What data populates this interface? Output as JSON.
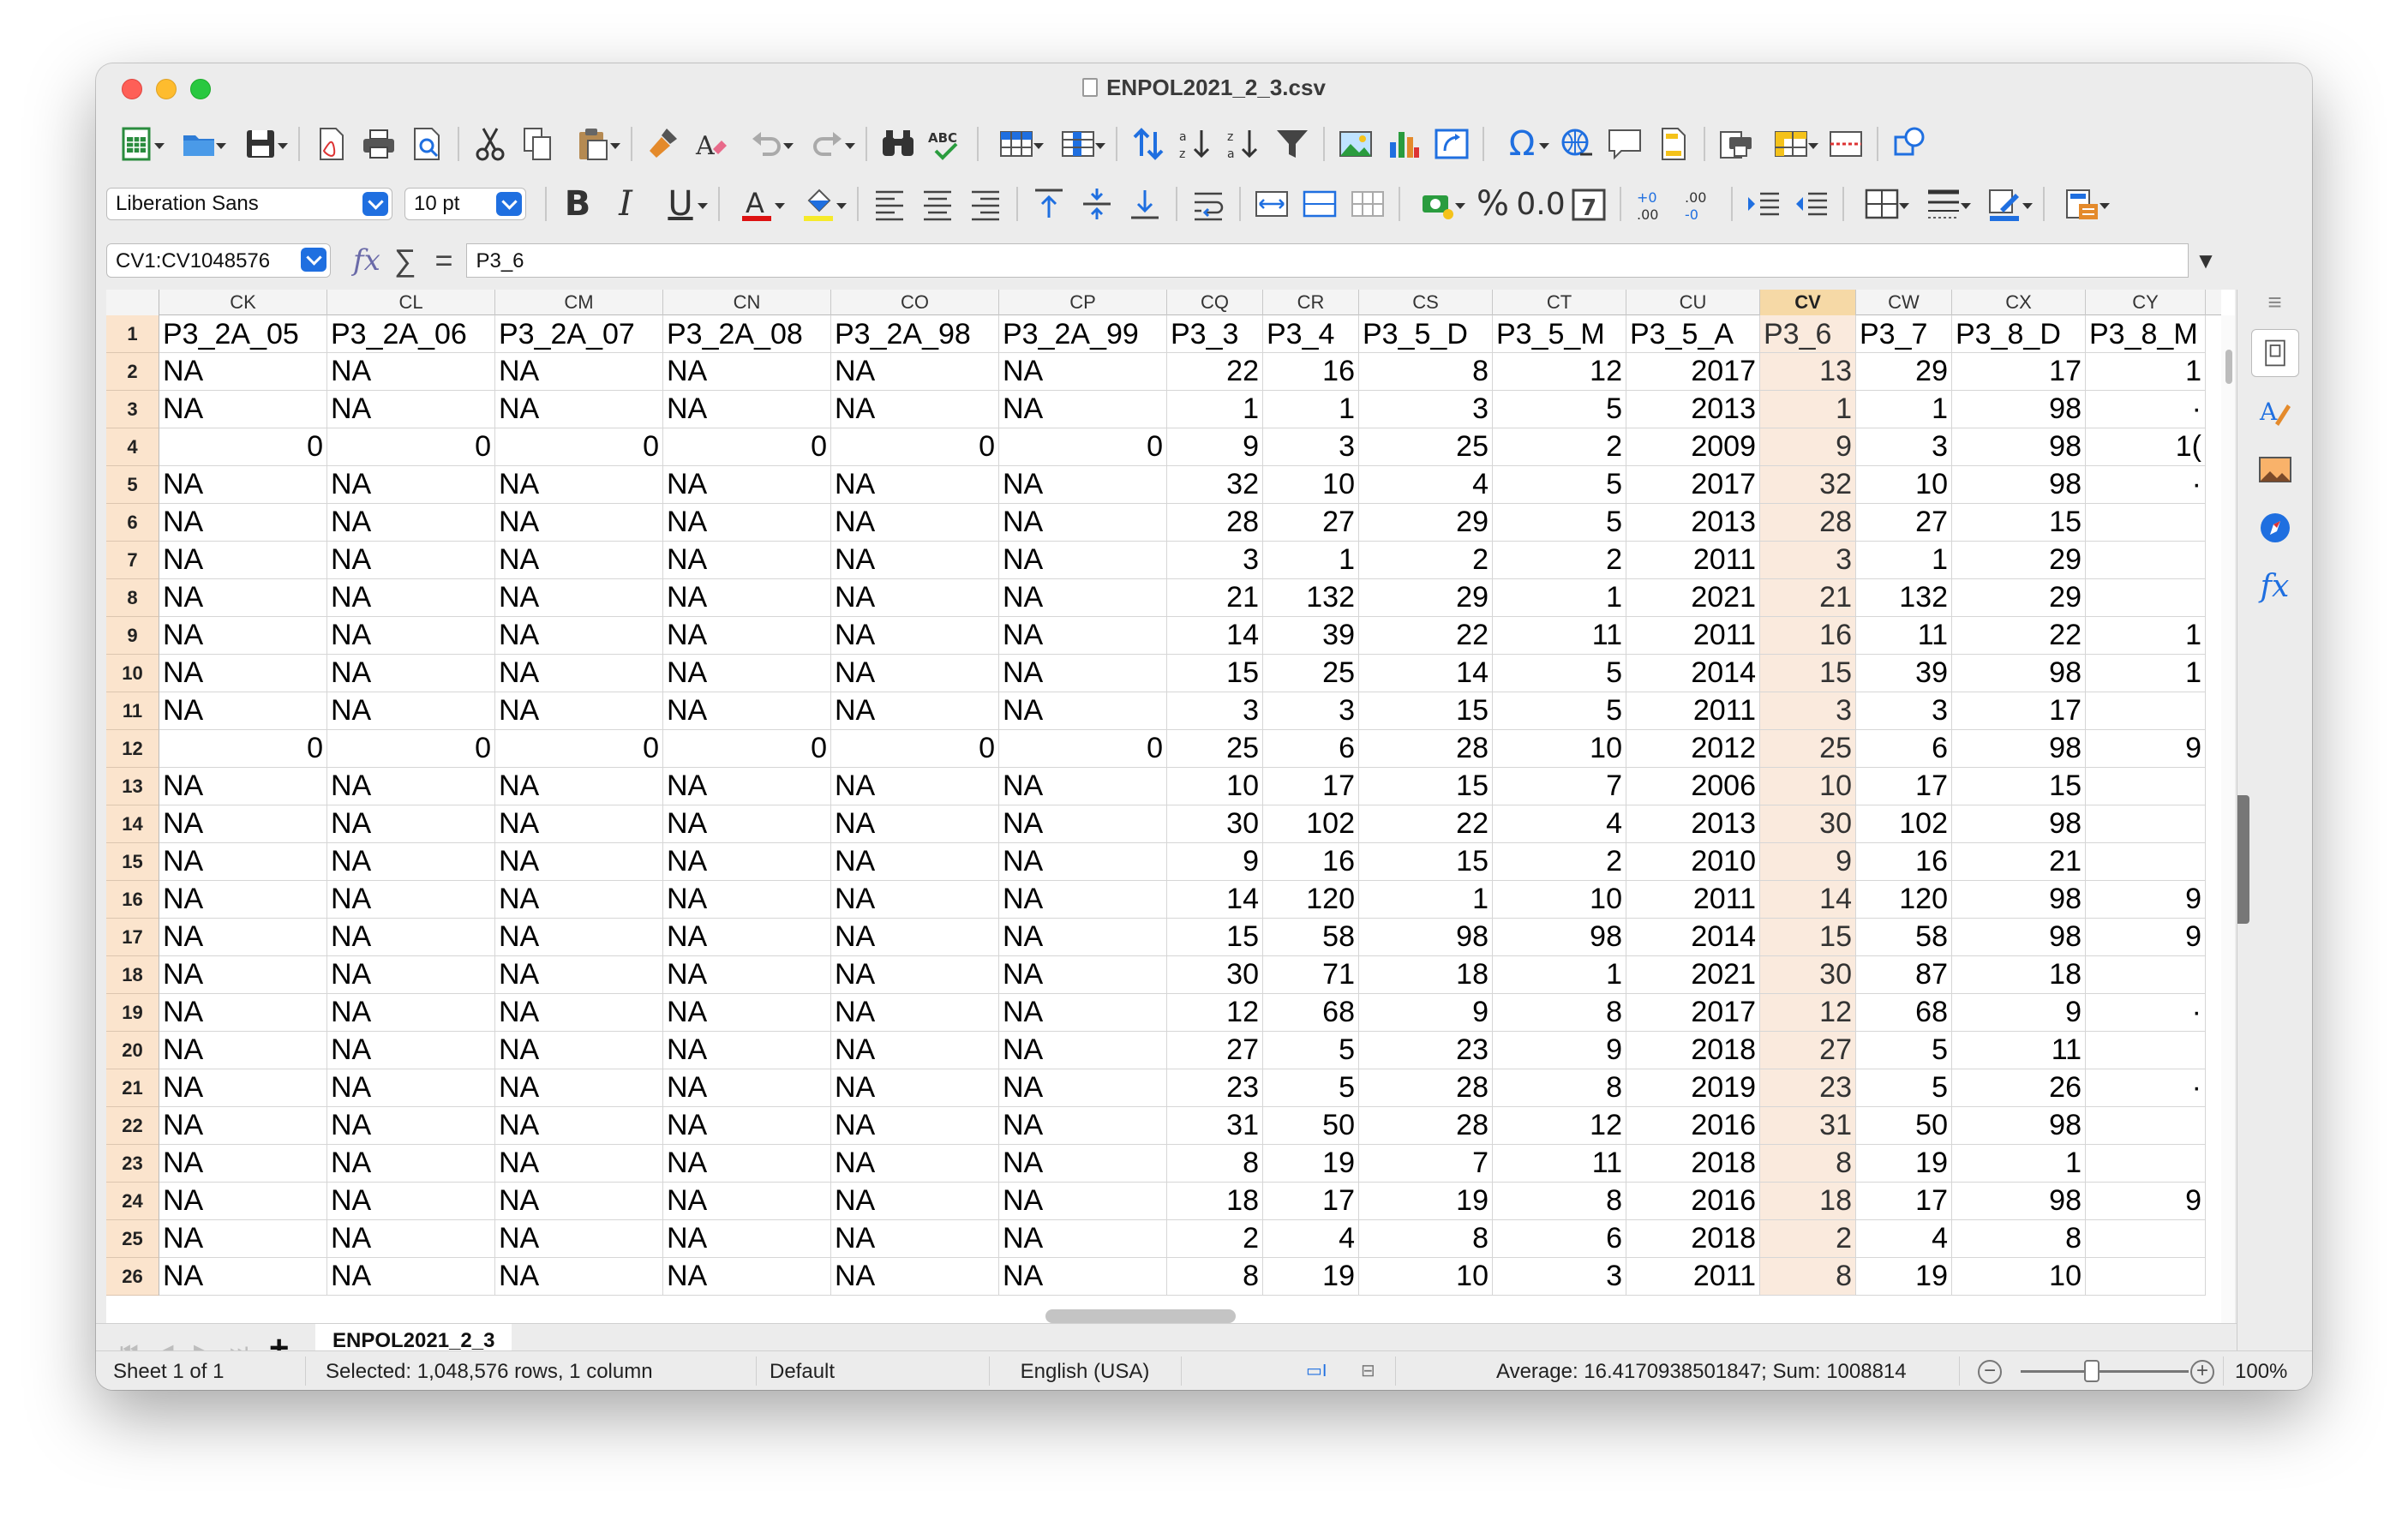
{
  "window": {
    "title": "ENPOL2021_2_3.csv"
  },
  "toolbar2": {
    "font_name": "Liberation Sans",
    "font_size": "10 pt",
    "percent": "%",
    "decimal": "0.0"
  },
  "formula": {
    "name_box": "CV1:CV1048576",
    "fx": "fx",
    "sigma": "∑",
    "equals": "=",
    "content": "P3_6"
  },
  "columns": [
    "CK",
    "CL",
    "CM",
    "CN",
    "CO",
    "CP",
    "CQ",
    "CR",
    "CS",
    "CT",
    "CU",
    "CV",
    "CW",
    "CX",
    "CY"
  ],
  "selected_column": "CV",
  "header_row": [
    "P3_2A_05",
    "P3_2A_06",
    "P3_2A_07",
    "P3_2A_08",
    "P3_2A_98",
    "P3_2A_99",
    "P3_3",
    "P3_4",
    "P3_5_D",
    "P3_5_M",
    "P3_5_A",
    "P3_6",
    "P3_7",
    "P3_8_D",
    "P3_8_M"
  ],
  "rows": [
    {
      "n": "2",
      "c": [
        "NA",
        "NA",
        "NA",
        "NA",
        "NA",
        "NA",
        "22",
        "16",
        "8",
        "12",
        "2017",
        "13",
        "29",
        "17",
        "1"
      ]
    },
    {
      "n": "3",
      "c": [
        "NA",
        "NA",
        "NA",
        "NA",
        "NA",
        "NA",
        "1",
        "1",
        "3",
        "5",
        "2013",
        "1",
        "1",
        "98",
        "·"
      ]
    },
    {
      "n": "4",
      "c": [
        "0",
        "0",
        "0",
        "0",
        "0",
        "0",
        "9",
        "3",
        "25",
        "2",
        "2009",
        "9",
        "3",
        "98",
        "1("
      ]
    },
    {
      "n": "5",
      "c": [
        "NA",
        "NA",
        "NA",
        "NA",
        "NA",
        "NA",
        "32",
        "10",
        "4",
        "5",
        "2017",
        "32",
        "10",
        "98",
        "·"
      ]
    },
    {
      "n": "6",
      "c": [
        "NA",
        "NA",
        "NA",
        "NA",
        "NA",
        "NA",
        "28",
        "27",
        "29",
        "5",
        "2013",
        "28",
        "27",
        "15",
        ""
      ]
    },
    {
      "n": "7",
      "c": [
        "NA",
        "NA",
        "NA",
        "NA",
        "NA",
        "NA",
        "3",
        "1",
        "2",
        "2",
        "2011",
        "3",
        "1",
        "29",
        ""
      ]
    },
    {
      "n": "8",
      "c": [
        "NA",
        "NA",
        "NA",
        "NA",
        "NA",
        "NA",
        "21",
        "132",
        "29",
        "1",
        "2021",
        "21",
        "132",
        "29",
        ""
      ]
    },
    {
      "n": "9",
      "c": [
        "NA",
        "NA",
        "NA",
        "NA",
        "NA",
        "NA",
        "14",
        "39",
        "22",
        "11",
        "2011",
        "16",
        "11",
        "22",
        "1"
      ]
    },
    {
      "n": "10",
      "c": [
        "NA",
        "NA",
        "NA",
        "NA",
        "NA",
        "NA",
        "15",
        "25",
        "14",
        "5",
        "2014",
        "15",
        "39",
        "98",
        "1"
      ]
    },
    {
      "n": "11",
      "c": [
        "NA",
        "NA",
        "NA",
        "NA",
        "NA",
        "NA",
        "3",
        "3",
        "15",
        "5",
        "2011",
        "3",
        "3",
        "17",
        ""
      ]
    },
    {
      "n": "12",
      "c": [
        "0",
        "0",
        "0",
        "0",
        "0",
        "0",
        "25",
        "6",
        "28",
        "10",
        "2012",
        "25",
        "6",
        "98",
        "9"
      ]
    },
    {
      "n": "13",
      "c": [
        "NA",
        "NA",
        "NA",
        "NA",
        "NA",
        "NA",
        "10",
        "17",
        "15",
        "7",
        "2006",
        "10",
        "17",
        "15",
        ""
      ]
    },
    {
      "n": "14",
      "c": [
        "NA",
        "NA",
        "NA",
        "NA",
        "NA",
        "NA",
        "30",
        "102",
        "22",
        "4",
        "2013",
        "30",
        "102",
        "98",
        ""
      ]
    },
    {
      "n": "15",
      "c": [
        "NA",
        "NA",
        "NA",
        "NA",
        "NA",
        "NA",
        "9",
        "16",
        "15",
        "2",
        "2010",
        "9",
        "16",
        "21",
        ""
      ]
    },
    {
      "n": "16",
      "c": [
        "NA",
        "NA",
        "NA",
        "NA",
        "NA",
        "NA",
        "14",
        "120",
        "1",
        "10",
        "2011",
        "14",
        "120",
        "98",
        "9"
      ]
    },
    {
      "n": "17",
      "c": [
        "NA",
        "NA",
        "NA",
        "NA",
        "NA",
        "NA",
        "15",
        "58",
        "98",
        "98",
        "2014",
        "15",
        "58",
        "98",
        "9"
      ]
    },
    {
      "n": "18",
      "c": [
        "NA",
        "NA",
        "NA",
        "NA",
        "NA",
        "NA",
        "30",
        "71",
        "18",
        "1",
        "2021",
        "30",
        "87",
        "18",
        ""
      ]
    },
    {
      "n": "19",
      "c": [
        "NA",
        "NA",
        "NA",
        "NA",
        "NA",
        "NA",
        "12",
        "68",
        "9",
        "8",
        "2017",
        "12",
        "68",
        "9",
        "·"
      ]
    },
    {
      "n": "20",
      "c": [
        "NA",
        "NA",
        "NA",
        "NA",
        "NA",
        "NA",
        "27",
        "5",
        "23",
        "9",
        "2018",
        "27",
        "5",
        "11",
        ""
      ]
    },
    {
      "n": "21",
      "c": [
        "NA",
        "NA",
        "NA",
        "NA",
        "NA",
        "NA",
        "23",
        "5",
        "28",
        "8",
        "2019",
        "23",
        "5",
        "26",
        "·"
      ]
    },
    {
      "n": "22",
      "c": [
        "NA",
        "NA",
        "NA",
        "NA",
        "NA",
        "NA",
        "31",
        "50",
        "28",
        "12",
        "2016",
        "31",
        "50",
        "98",
        ""
      ]
    },
    {
      "n": "23",
      "c": [
        "NA",
        "NA",
        "NA",
        "NA",
        "NA",
        "NA",
        "8",
        "19",
        "7",
        "11",
        "2018",
        "8",
        "19",
        "1",
        ""
      ]
    },
    {
      "n": "24",
      "c": [
        "NA",
        "NA",
        "NA",
        "NA",
        "NA",
        "NA",
        "18",
        "17",
        "19",
        "8",
        "2016",
        "18",
        "17",
        "98",
        "9"
      ]
    },
    {
      "n": "25",
      "c": [
        "NA",
        "NA",
        "NA",
        "NA",
        "NA",
        "NA",
        "2",
        "4",
        "8",
        "6",
        "2018",
        "2",
        "4",
        "8",
        ""
      ]
    },
    {
      "n": "26",
      "c": [
        "NA",
        "NA",
        "NA",
        "NA",
        "NA",
        "NA",
        "8",
        "19",
        "10",
        "3",
        "2011",
        "8",
        "19",
        "10",
        ""
      ]
    }
  ],
  "sheet_tab": "ENPOL2021_2_3",
  "status": {
    "sheet": "Sheet 1 of 1",
    "selection": "Selected: 1,048,576 rows, 1 column",
    "style": "Default",
    "language": "English (USA)",
    "summary": "Average: 16.4170938501847; Sum: 1008814",
    "zoom": "100%"
  }
}
